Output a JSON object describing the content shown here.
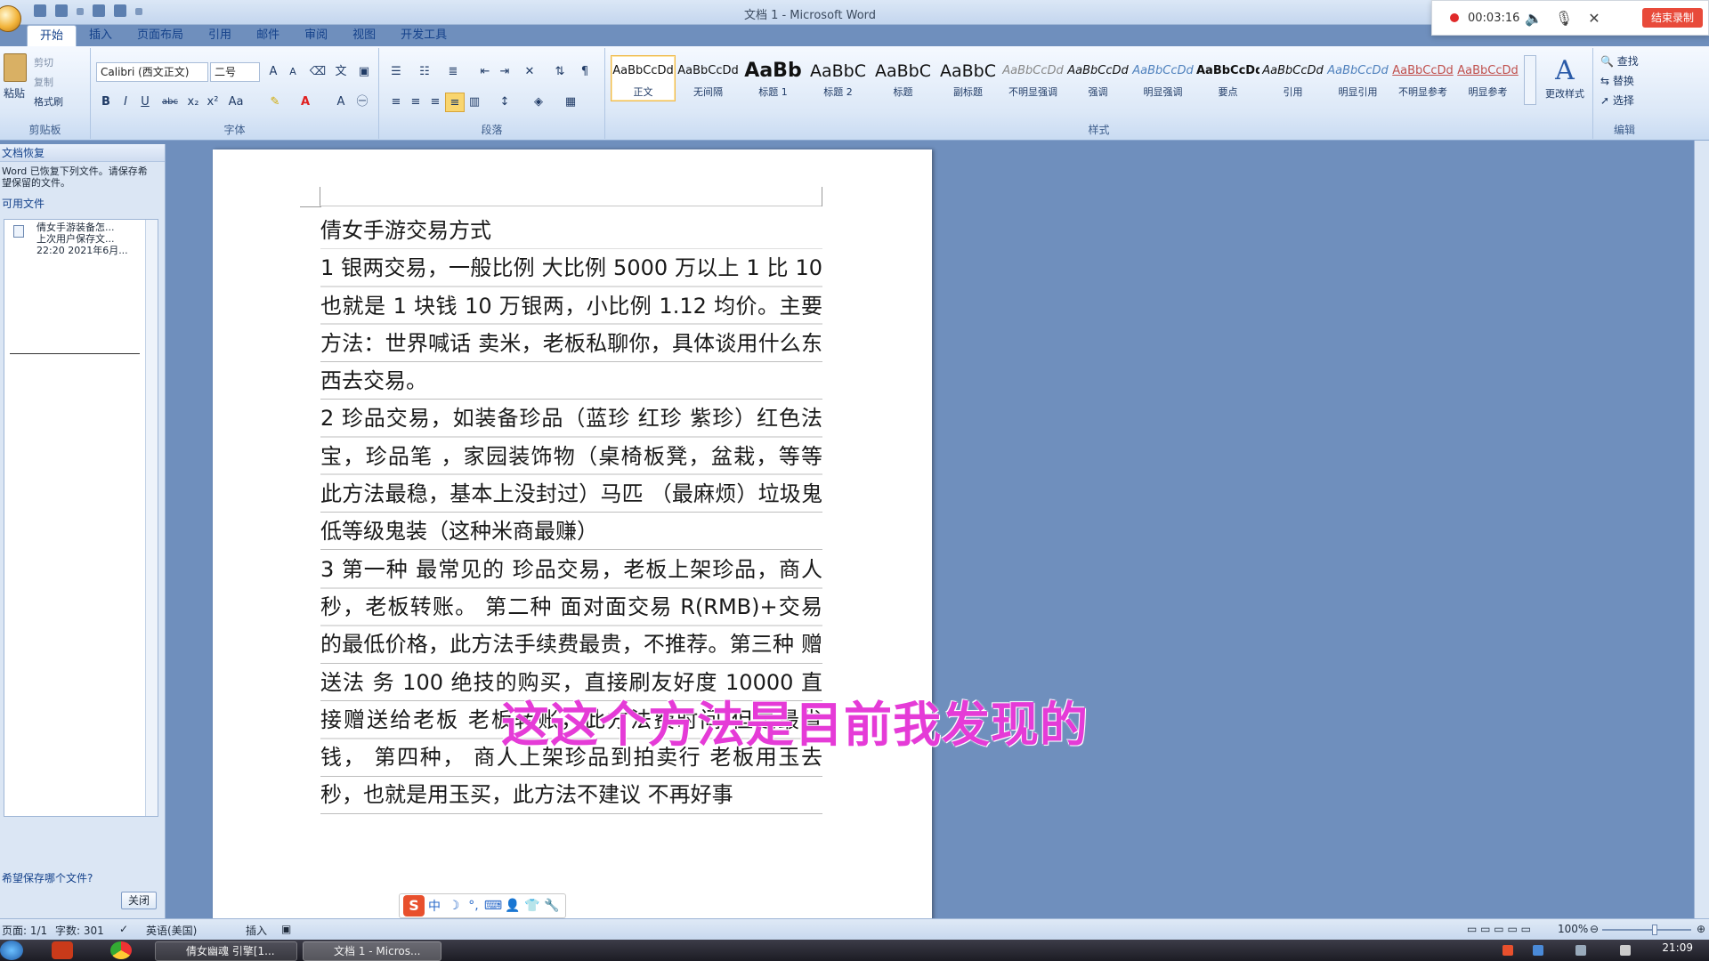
{
  "window": {
    "title": "文档 1 - Microsoft Word"
  },
  "recorder": {
    "time": "00:03:16",
    "stop_label": "结束录制"
  },
  "ribbon": {
    "tabs": [
      "开始",
      "插入",
      "页面布局",
      "引用",
      "邮件",
      "审阅",
      "视图",
      "开发工具"
    ],
    "active_tab": "开始",
    "clipboard": {
      "paste": "粘贴",
      "cut": "剪切",
      "copy": "复制",
      "format_painter": "格式刷",
      "group": "剪贴板"
    },
    "font": {
      "name": "Calibri (西文正文)",
      "size": "二号",
      "group": "字体"
    },
    "paragraph": {
      "group": "段落"
    },
    "styles": {
      "group": "样式",
      "items": [
        {
          "sample": "AaBbCcDd",
          "name": "正文"
        },
        {
          "sample": "AaBbCcDd",
          "name": "无间隔"
        },
        {
          "sample": "AaBb",
          "name": "标题 1"
        },
        {
          "sample": "AaBbC",
          "name": "标题 2"
        },
        {
          "sample": "AaBbC",
          "name": "标题"
        },
        {
          "sample": "AaBbC",
          "name": "副标题"
        },
        {
          "sample": "AaBbCcDd",
          "name": "不明显强调"
        },
        {
          "sample": "AaBbCcDd",
          "name": "强调"
        },
        {
          "sample": "AaBbCcDd",
          "name": "明显强调"
        },
        {
          "sample": "AaBbCcDd",
          "name": "要点"
        },
        {
          "sample": "AaBbCcDd",
          "name": "引用"
        },
        {
          "sample": "AaBbCcDd",
          "name": "明显引用"
        },
        {
          "sample": "AaBbCcDd",
          "name": "不明显参考"
        },
        {
          "sample": "AaBbCcDd",
          "name": "明显参考"
        }
      ],
      "change_styles": "更改样式"
    },
    "editing": {
      "find": "查找",
      "replace": "替换",
      "select": "选择",
      "group": "编辑"
    }
  },
  "recovery": {
    "title": "文档恢复",
    "note_line1": "Word 已恢复下列文件。请保存希",
    "note_line2": "望保留的文件。",
    "available_label": "可用文件",
    "file_name": "倩女手游装备怎...",
    "file_info": "上次用户保存文...",
    "file_time": "22:20 2021年6月...",
    "question": "希望保存哪个文件?",
    "close_label": "关闭"
  },
  "document": {
    "paragraphs": [
      "倩女手游交易方式",
      "1 银两交易，一般比例  大比例 5000 万以上 1 比 10  也就是 1 块钱 10 万银两，小比例 1.12 均价。主要方法：世界喊话 卖米，老板私聊你，具体谈用什么东西去交易。",
      "2 珍品交易，如装备珍品（蓝珍 红珍 紫珍）红色法宝，珍品笔 ，家园装饰物（桌椅板凳，盆栽，等等 此方法最稳，基本上没封过）马匹 （最麻烦）垃圾鬼 低等级鬼装（这种米商最赚）",
      "3 第一种 最常见的 珍品交易，老板上架珍品，商人秒，老板转账。 第二种 面对面交易  R(RMB)+交易的最低价格，此方法手续费最贵，不推荐。第三种 赠送法 务 100 绝技的购买，直接刷友好度 10000 直接赠送给老板 老板转账，此方法费时间 但是最省钱，  第四种， 商人上架珍品到拍卖行 老板用玉去秒，也就是用玉买，此方法不建议 不再好事"
    ]
  },
  "subtitle": "这这个方法是目前我发现的",
  "ime": {
    "mode": "中"
  },
  "statusbar": {
    "page": "页面: 1/1",
    "words": "字数: 301",
    "language": "英语(美国)",
    "mode": "插入",
    "zoom": "100%"
  },
  "taskbar": {
    "items": [
      "倩女幽魂 引擎[1...",
      "文档 1 - Micros..."
    ],
    "clock": "21:09"
  }
}
